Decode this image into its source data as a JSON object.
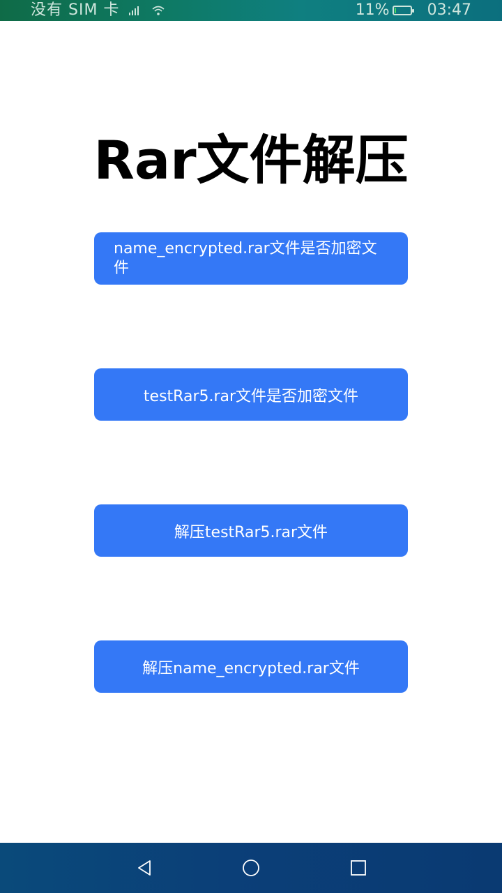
{
  "status_bar": {
    "carrier": "没有 SIM 卡",
    "signal_icon": "signal-x-icon",
    "wifi_icon": "wifi-icon",
    "battery_percent": "11%",
    "battery_level": 0.11,
    "battery_color": "#4cd964",
    "time": "03:47"
  },
  "title": "Rar文件解压",
  "buttons": [
    {
      "label": "name_encrypted.rar文件是否加密文件"
    },
    {
      "label": "testRar5.rar文件是否加密文件"
    },
    {
      "label": "解压testRar5.rar文件"
    },
    {
      "label": "解压name_encrypted.rar文件"
    }
  ],
  "accent_color": "#3478f6",
  "nav_bar": {
    "back_icon": "back-triangle-icon",
    "home_icon": "home-circle-icon",
    "recent_icon": "recent-square-icon"
  }
}
